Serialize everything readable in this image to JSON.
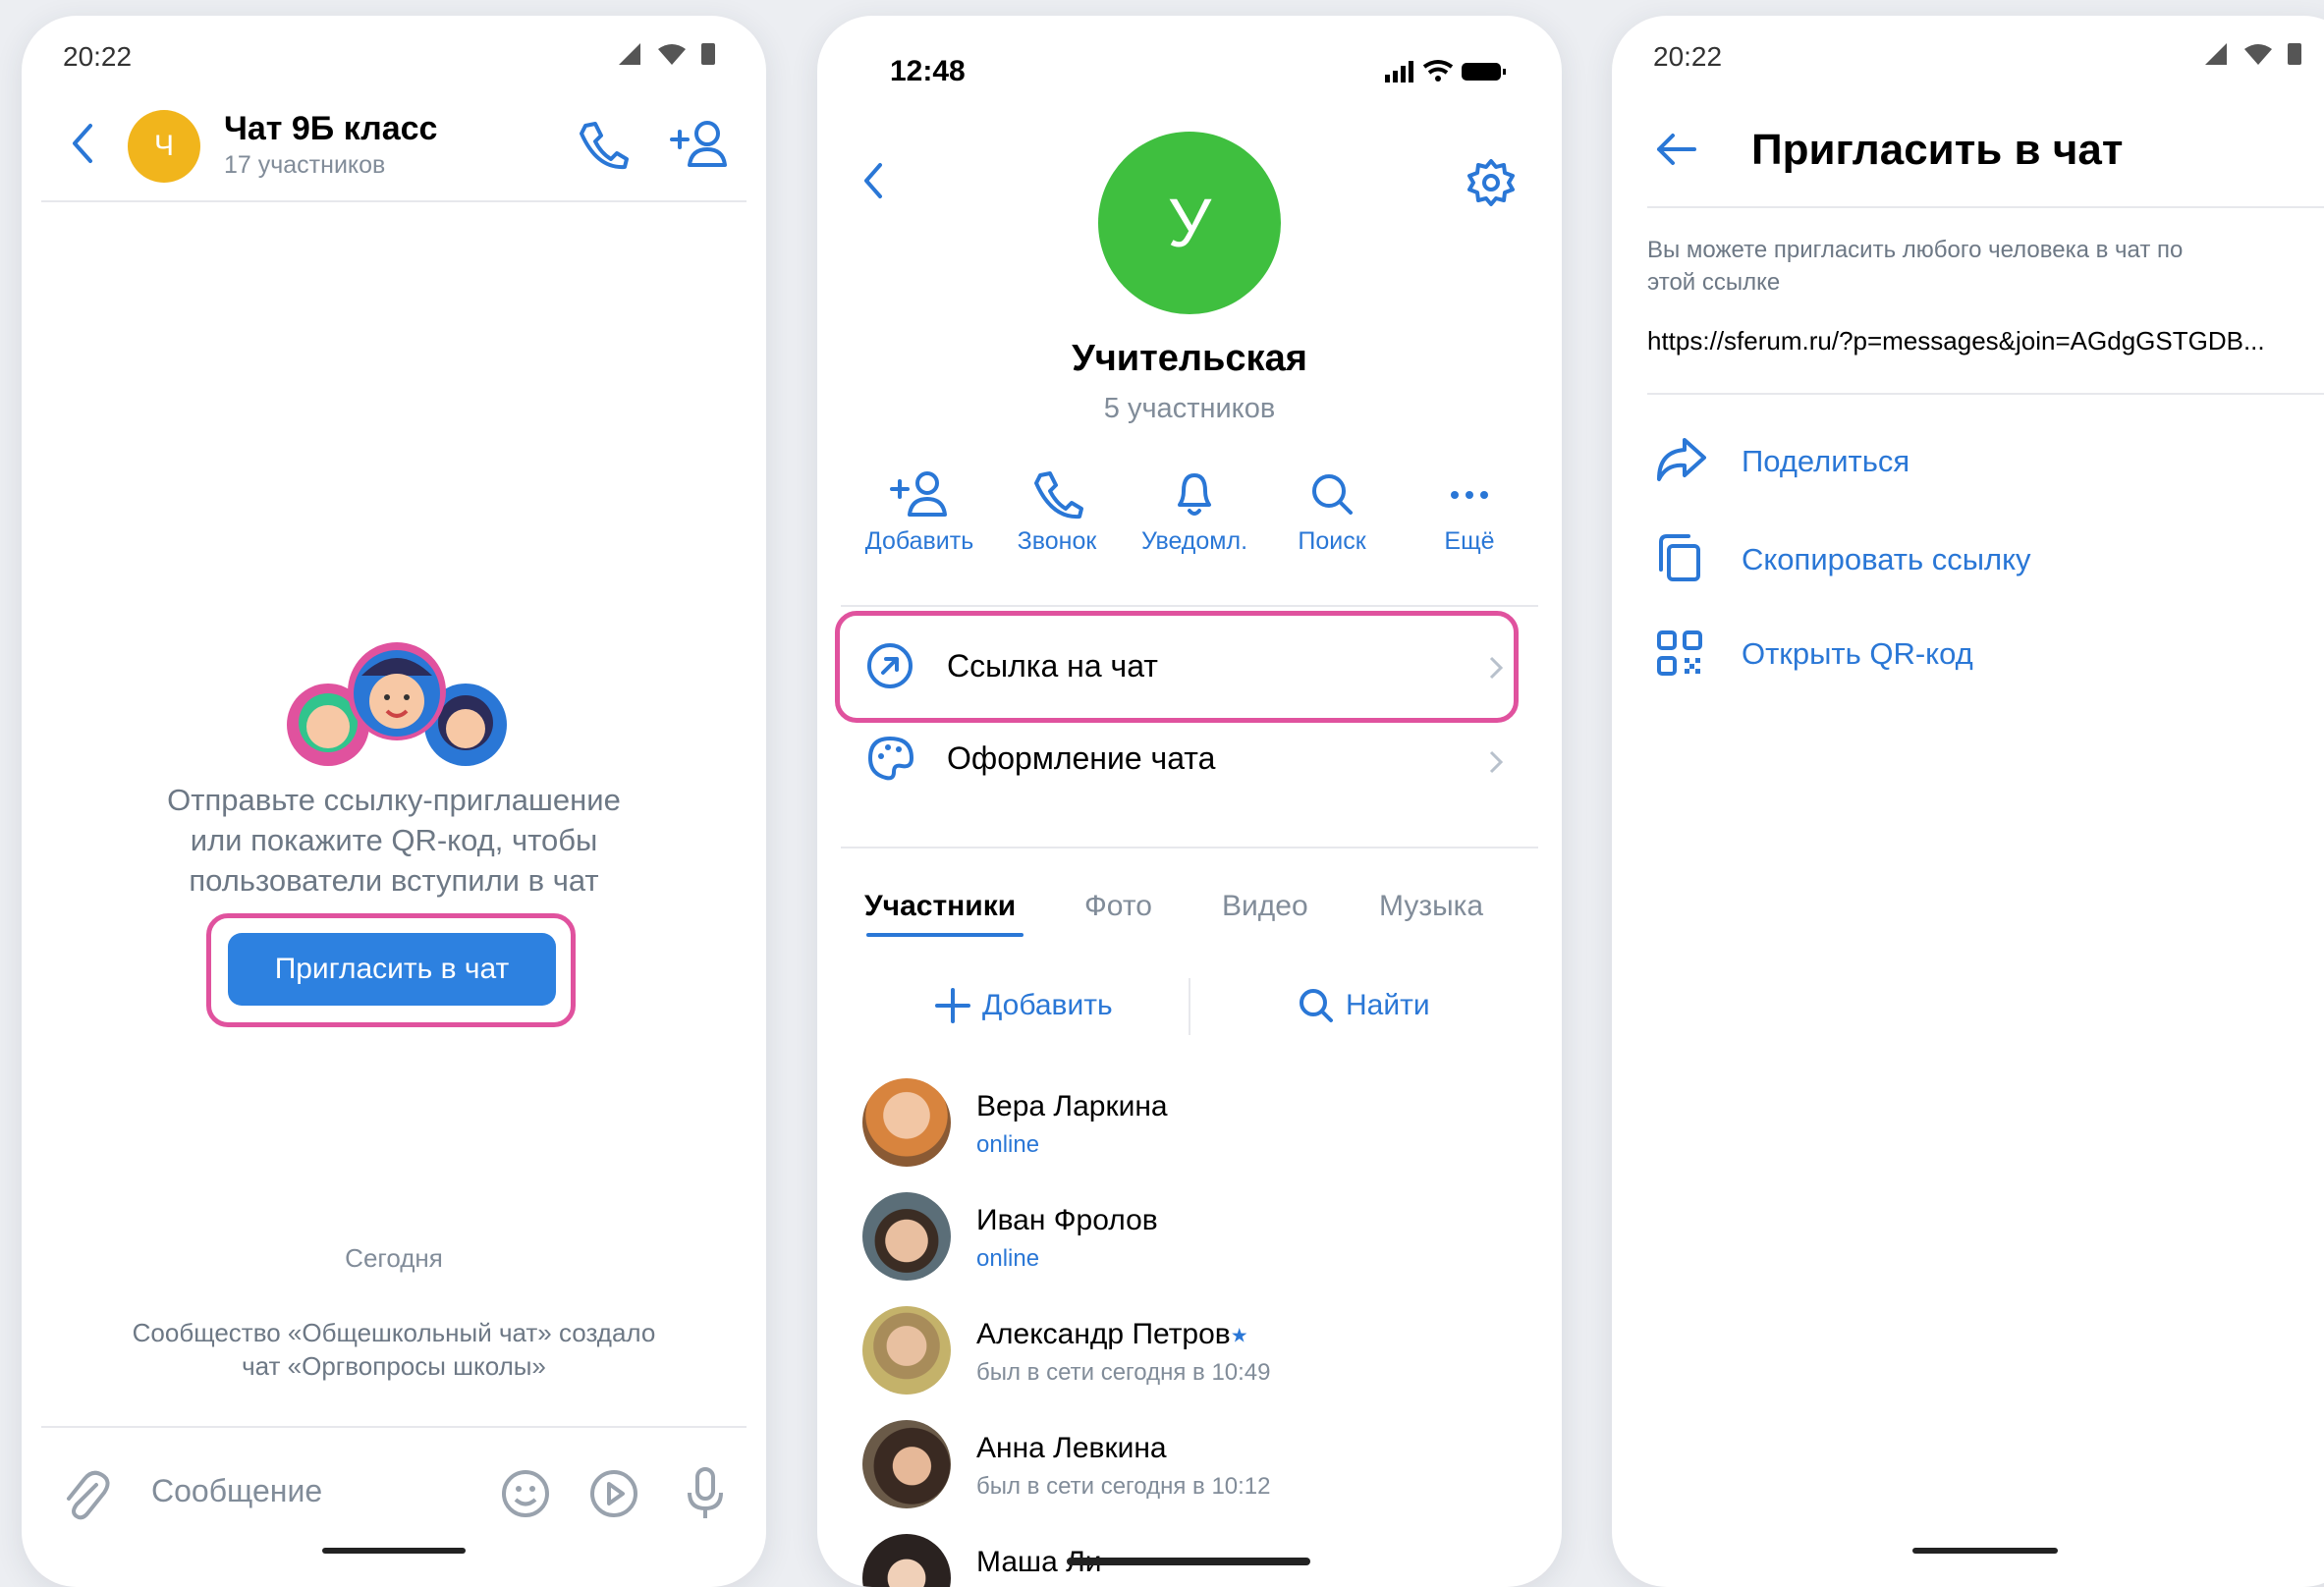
{
  "screen1": {
    "time": "20:22",
    "chat_title": "Чат 9Б класс",
    "chat_subtitle": "17 участников",
    "avatar_letter": "Ч",
    "invite_text_lines": [
      "Отправьте ссылку-приглашение",
      "или покажите QR-код, чтобы",
      "пользователи вступили в чат"
    ],
    "invite_button": "Пригласить в чат",
    "date_label": "Сегодня",
    "system_message_line1": "Сообщество «Общешкольный чат» создало",
    "system_message_line2": "чат «Оргвопросы школы»",
    "message_placeholder": "Сообщение"
  },
  "screen2": {
    "time": "12:48",
    "avatar_letter": "У",
    "title": "Учительская",
    "subtitle": "5 участников",
    "actions": [
      {
        "label": "Добавить",
        "icon": "add-user-icon"
      },
      {
        "label": "Звонок",
        "icon": "phone-icon"
      },
      {
        "label": "Уведомл.",
        "icon": "bell-icon"
      },
      {
        "label": "Поиск",
        "icon": "search-icon"
      },
      {
        "label": "Ещё",
        "icon": "more-icon"
      }
    ],
    "menu": {
      "chat_link": "Ссылка на чат",
      "chat_design": "Оформление чата"
    },
    "tabs": [
      "Участники",
      "Фото",
      "Видео",
      "Музыка"
    ],
    "add_label": "Добавить",
    "find_label": "Найти",
    "members": [
      {
        "name": "Вера Ларкина",
        "status": "online",
        "online": true
      },
      {
        "name": "Иван Фролов",
        "status": "online",
        "online": true
      },
      {
        "name": "Александр Петров",
        "status": "был в сети сегодня в 10:49",
        "online": false,
        "star": "★"
      },
      {
        "name": "Анна Левкина",
        "status": "был в сети сегодня в 10:12",
        "online": false
      },
      {
        "name": "Маша Ли",
        "status": "",
        "online": false
      }
    ]
  },
  "screen3": {
    "time": "20:22",
    "title": "Пригласить в чат",
    "description_line1": "Вы можете пригласить любого человека в чат по",
    "description_line2": "этой ссылке",
    "link": "https://sferum.ru/?p=messages&join=AGdgGSTGDB...",
    "actions": [
      {
        "label": "Поделиться",
        "icon": "share-icon"
      },
      {
        "label": "Скопировать ссылку",
        "icon": "copy-icon"
      },
      {
        "label": "Открыть QR-код",
        "icon": "qr-code-icon"
      }
    ]
  },
  "colors": {
    "accent": "#2a77d6",
    "highlight": "#e0529e",
    "avatar_yellow": "#f1b51c",
    "avatar_green": "#3fbf3f"
  }
}
